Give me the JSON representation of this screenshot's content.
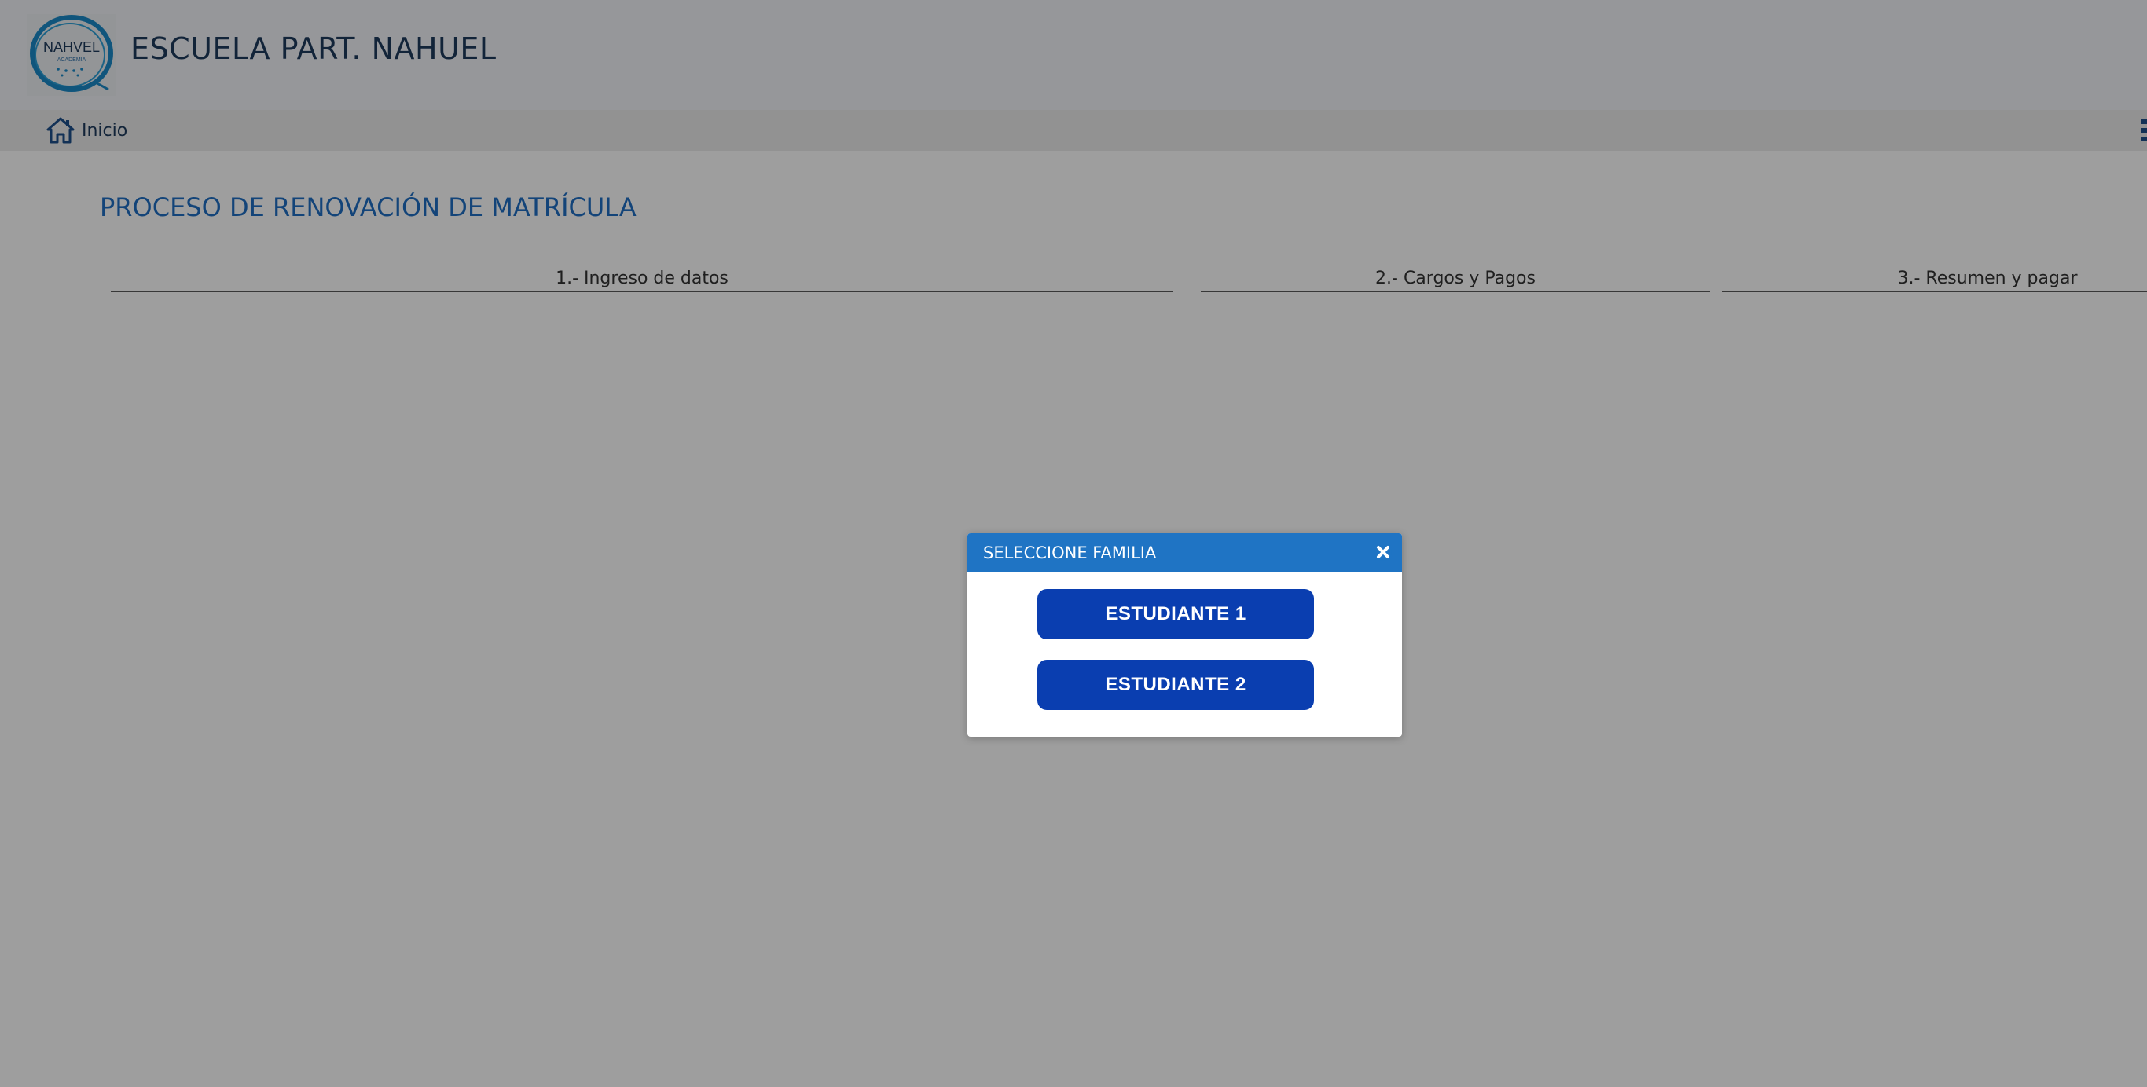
{
  "header": {
    "logo_text": "NAHVEL",
    "logo_subtext": "ACADEMIA",
    "school_name": "ESCUELA PART. NAHUEL"
  },
  "navbar": {
    "home_icon": "home-icon",
    "home_label": "Inicio",
    "menu_icon": "menu-icon"
  },
  "main": {
    "page_title": "PROCESO DE RENOVACIÓN DE MATRÍCULA",
    "steps": [
      {
        "label": "1.- Ingreso de datos"
      },
      {
        "label": "2.- Cargos y Pagos"
      },
      {
        "label": "3.- Resumen y pagar"
      }
    ]
  },
  "modal": {
    "title": "SELECCIONE FAMILIA",
    "close_icon": "close-icon",
    "buttons": [
      {
        "label": "ESTUDIANTE 1"
      },
      {
        "label": "ESTUDIANTE 2"
      }
    ]
  },
  "colors": {
    "accent_blue": "#1f74c4",
    "button_blue": "#0a3eb0",
    "title_blue": "#1f6fc4",
    "header_text": "#1e3a5c",
    "overlay": "rgba(0,0,0,0.38)"
  }
}
